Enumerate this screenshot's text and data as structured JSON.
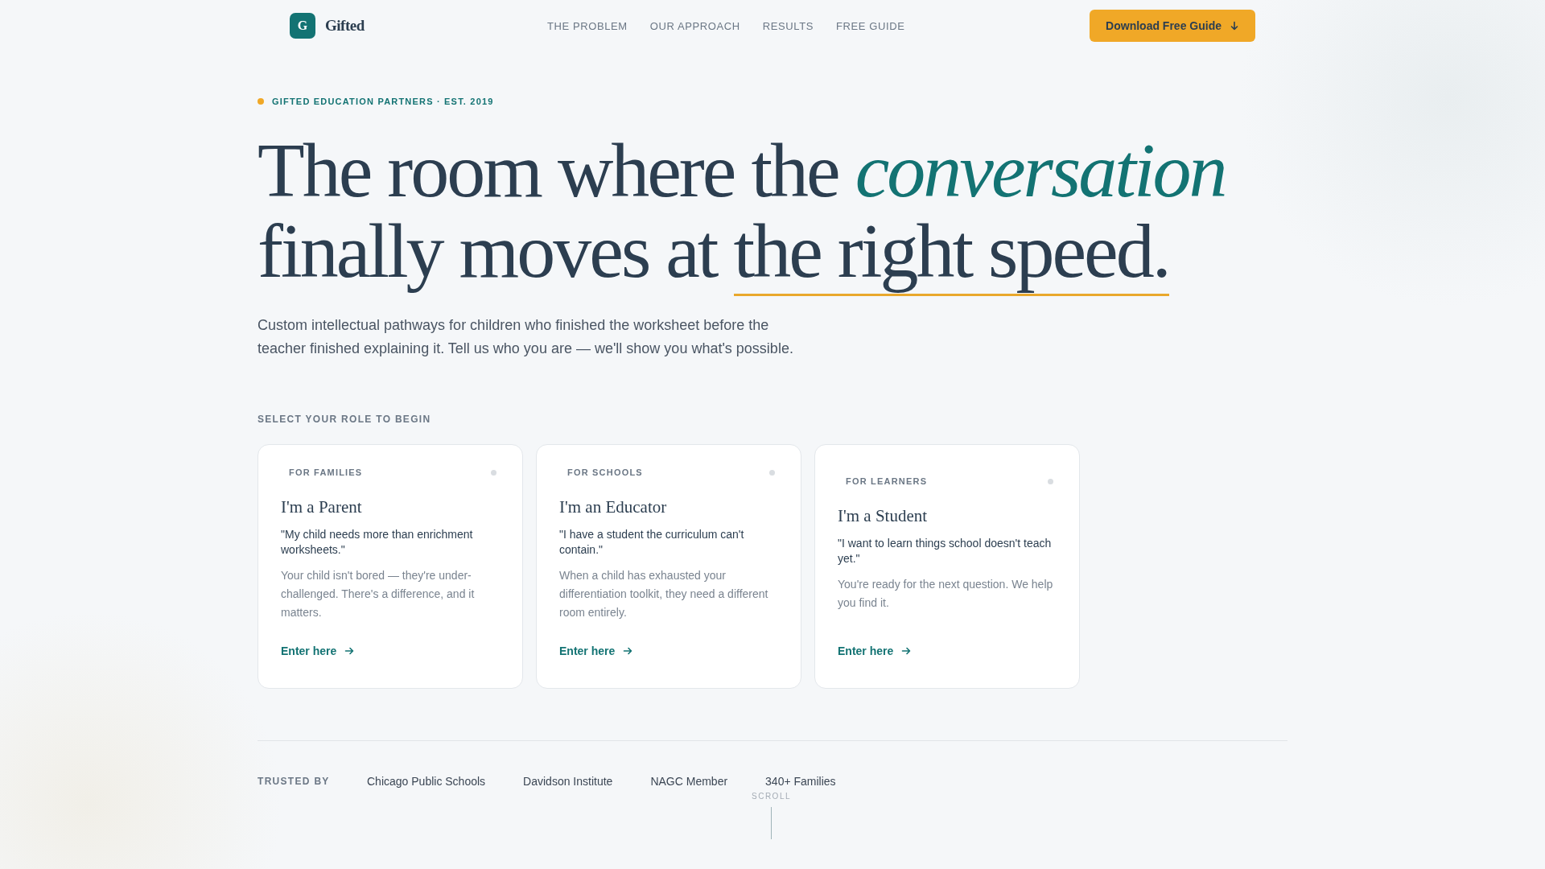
{
  "header": {
    "logo_mark": "G",
    "logo_text": "Gifted",
    "nav": [
      "THE PROBLEM",
      "OUR APPROACH",
      "RESULTS",
      "FREE GUIDE"
    ],
    "cta": "Download Free Guide"
  },
  "hero": {
    "eyebrow": "GIFTED EDUCATION PARTNERS · EST. 2019",
    "headline_start": "The room where the ",
    "headline_accent": "conversation",
    "headline_middle": "finally moves at ",
    "headline_underlined": "the right speed.",
    "intro": "Custom intellectual pathways for children who finished the worksheet before the teacher finished explaining it. Tell us who you are — we'll show you what's possible."
  },
  "roles": {
    "label": "SELECT YOUR ROLE TO BEGIN",
    "cards": [
      {
        "tag": "FOR FAMILIES",
        "title": "I'm a Parent",
        "quote": "\"My child needs more than enrichment worksheets.\"",
        "body": "Your child isn't bored — they're under-challenged. There's a difference, and it matters.",
        "link": "Enter here"
      },
      {
        "tag": "FOR SCHOOLS",
        "title": "I'm an Educator",
        "quote": "\"I have a student the curriculum can't contain.\"",
        "body": "When a child has exhausted your differentiation toolkit, they need a different room entirely.",
        "link": "Enter here"
      },
      {
        "tag": "FOR LEARNERS",
        "title": "I'm a Student",
        "quote": "\"I want to learn things school doesn't teach yet.\"",
        "body": "You're ready for the next question. We help you find it.",
        "link": "Enter here"
      }
    ]
  },
  "trusted": {
    "label": "TRUSTED BY",
    "items": [
      "Chicago Public Schools",
      "Davidson Institute",
      "NAGC Member",
      "340+ Families"
    ]
  },
  "scroll_hint": "SCROLL"
}
